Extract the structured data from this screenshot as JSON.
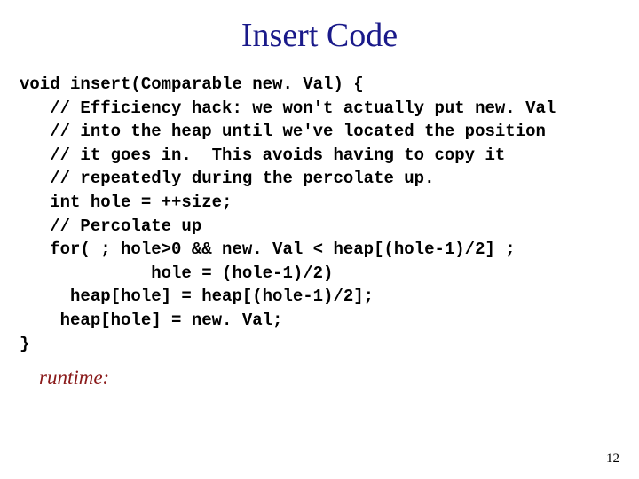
{
  "slide": {
    "title": "Insert Code",
    "code": "void insert(Comparable new. Val) {\n   // Efficiency hack: we won't actually put new. Val\n   // into the heap until we've located the position\n   // it goes in.  This avoids having to copy it\n   // repeatedly during the percolate up.\n   int hole = ++size;\n   // Percolate up\n   for( ; hole>0 && new. Val < heap[(hole-1)/2] ;\n             hole = (hole-1)/2)\n     heap[hole] = heap[(hole-1)/2];\n    heap[hole] = new. Val;\n}",
    "runtime_label": "runtime:",
    "page_number": "12"
  }
}
